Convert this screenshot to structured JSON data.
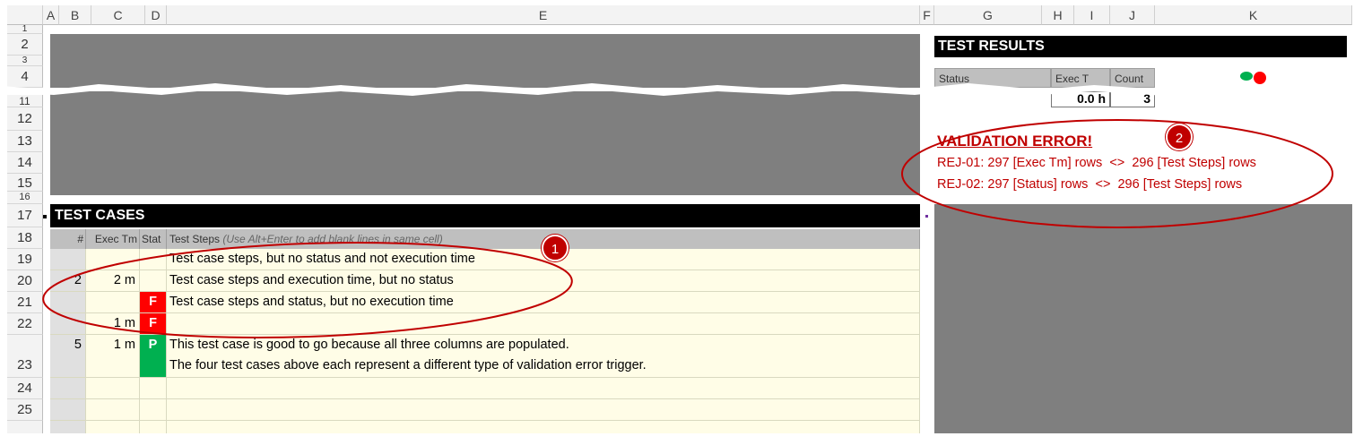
{
  "columns": [
    "A",
    "B",
    "C",
    "D",
    "E",
    "F",
    "G",
    "H",
    "I",
    "J",
    "K"
  ],
  "rows": {
    "top": [
      "1",
      "2",
      "3",
      "4"
    ],
    "mid": [
      "11",
      "12",
      "13",
      "14",
      "15",
      "16",
      "17",
      "18",
      "19",
      "20",
      "21",
      "22",
      "23",
      "24",
      "25"
    ]
  },
  "results": {
    "title": "TEST RESULTS",
    "col_status": "Status",
    "col_exec": "Exec T",
    "col_count": "Count",
    "exec_value": "0.0 h",
    "count_value": "3"
  },
  "validation": {
    "title": "VALIDATION ERROR!",
    "line1": "REJ-01: 297 [Exec Tm] rows  <>  296 [Test Steps] rows",
    "line2": "REJ-02: 297 [Status] rows  <>  296 [Test Steps] rows"
  },
  "test_cases": {
    "title": "TEST CASES",
    "headers": {
      "num": "#",
      "exec": "Exec Tm",
      "stat": "Stat",
      "steps": "Test Steps",
      "steps_hint": "(Use Alt+Enter to add blank lines in same cell)"
    },
    "rows": [
      {
        "num": "",
        "exec": "",
        "stat": "",
        "steps": "Test case steps, but no status and not execution time"
      },
      {
        "num": "2",
        "exec": "2 m",
        "stat": "",
        "steps": "Test case steps and execution time, but no status"
      },
      {
        "num": "",
        "exec": "",
        "stat": "F",
        "steps": "Test case steps and status, but no execution time"
      },
      {
        "num": "",
        "exec": "1 m",
        "stat": "F",
        "steps": ""
      },
      {
        "num": "5",
        "exec": "1 m",
        "stat": "P",
        "steps": "This test case is good to go because all three columns are populated.",
        "steps2": "The four test cases above each represent a different type of validation error trigger."
      }
    ]
  },
  "markers": {
    "one": "1",
    "two": "2"
  },
  "colors": {
    "fail": "#ff0000",
    "pass": "#00b050",
    "error_text": "#c00000",
    "row_fill": "#fffde7"
  }
}
